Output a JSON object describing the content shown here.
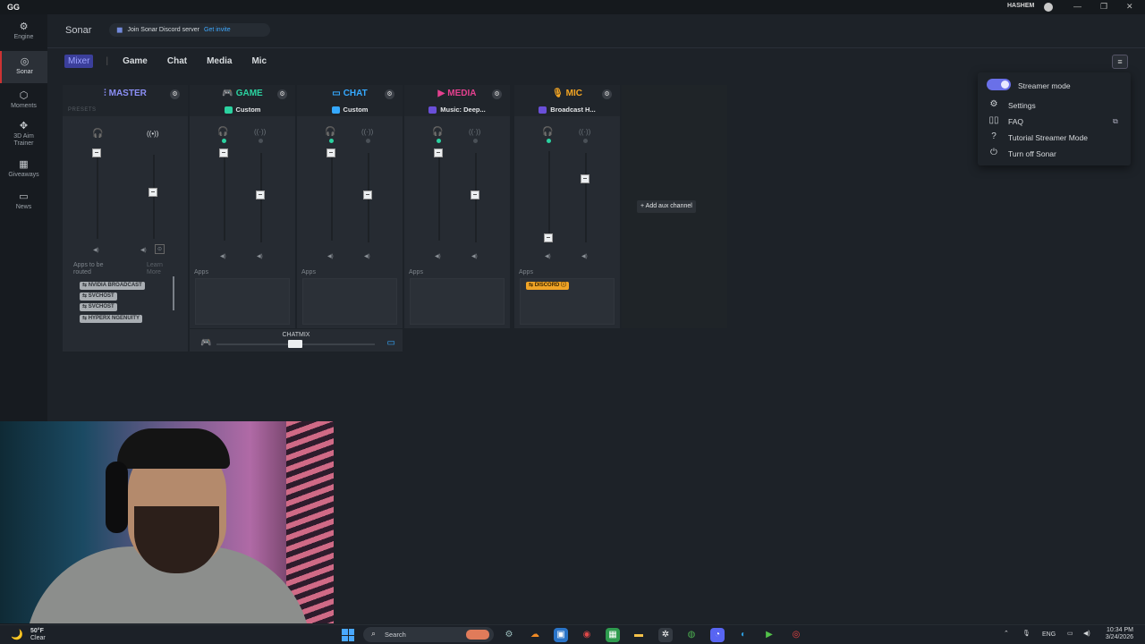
{
  "titlebar": {
    "logo": "GG",
    "username": "HASHEM"
  },
  "rail": [
    {
      "label": "Engine",
      "icon": "engine-icon",
      "glyph": "⚙"
    },
    {
      "label": "Sonar",
      "icon": "sonar-icon",
      "glyph": "◎"
    },
    {
      "label": "Moments",
      "icon": "moments-icon",
      "glyph": "⬡"
    },
    {
      "label": "3D Aim Trainer",
      "icon": "aim-trainer-icon",
      "glyph": "✥"
    },
    {
      "label": "Giveaways",
      "icon": "giveaways-icon",
      "glyph": "▦"
    },
    {
      "label": "News",
      "icon": "news-icon",
      "glyph": "▭"
    }
  ],
  "header": {
    "title": "Sonar",
    "discord_text": "Join Sonar Discord server",
    "invite_label": "Get invite"
  },
  "tabs": [
    "Mixer",
    "Game",
    "Chat",
    "Media",
    "Mic"
  ],
  "master": {
    "title": "MASTER",
    "presets_label": "PRESETS",
    "apps_label": "Apps to be routed",
    "learn_more": "Learn More",
    "apps": [
      "NVIDIA BROADCAST",
      "SVCHOST",
      "SVCHOST",
      "HYPERX NGENUITY"
    ]
  },
  "channels": [
    {
      "title": "GAME",
      "preset": "Custom",
      "apps_label": "Apps",
      "color": "#2bd2a0"
    },
    {
      "title": "CHAT",
      "preset": "Custom",
      "apps_label": "Apps",
      "color": "#35a9ff"
    },
    {
      "title": "MEDIA",
      "preset": "Music: Deep...",
      "apps_label": "Apps",
      "color": "#e5408f"
    },
    {
      "title": "MIC",
      "preset": "Broadcast H...",
      "apps_label": "Apps",
      "color": "#f5a623",
      "app": "DISCORD"
    }
  ],
  "aux": {
    "label": "+ Add aux channel"
  },
  "chatmix": {
    "label": "CHATMIX"
  },
  "menu": {
    "streamer_mode": "Streamer mode",
    "settings": "Settings",
    "faq": "FAQ",
    "tutorial": "Tutorial Streamer Mode",
    "turn_off": "Turn off Sonar"
  },
  "taskbar": {
    "temperature": "50°F",
    "condition": "Clear",
    "search_placeholder": "Search",
    "language": "ENG",
    "time": "10:34 PM",
    "date": "3/24/2026"
  },
  "colors": {
    "accent": "#6a70e8",
    "game": "#2bd2a0",
    "chat": "#35a9ff",
    "media": "#e5408f",
    "mic": "#f5a623"
  }
}
